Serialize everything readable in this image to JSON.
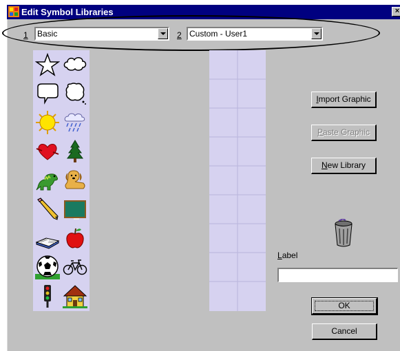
{
  "window": {
    "title": "Edit Symbol Libraries",
    "close": "×"
  },
  "combos": [
    {
      "number": "1",
      "value": "Basic"
    },
    {
      "number": "2",
      "value": "Custom - User1"
    }
  ],
  "symbols": [
    [
      "star",
      "cloud"
    ],
    [
      "speech-bubble",
      "thought-bubble"
    ],
    [
      "sun",
      "rain-cloud"
    ],
    [
      "heart",
      "tree"
    ],
    [
      "dinosaur",
      "dog"
    ],
    [
      "pencil",
      "chalkboard"
    ],
    [
      "book",
      "apple"
    ],
    [
      "soccer-ball",
      "bicycle"
    ],
    [
      "traffic-light",
      "house"
    ]
  ],
  "buttons": {
    "import_graphic": {
      "first": "I",
      "rest": "mport Graphic"
    },
    "paste_graphic": {
      "first": "P",
      "rest": "aste Graphic"
    },
    "new_library": {
      "first": "N",
      "rest": "ew Library"
    },
    "ok": "OK",
    "cancel": "Cancel"
  },
  "label": {
    "first": "L",
    "rest": "abel",
    "value": ""
  },
  "colors": {
    "titlebar": "#000080",
    "dialog": "#c0c0c0",
    "grid": "#d6d2f0"
  }
}
